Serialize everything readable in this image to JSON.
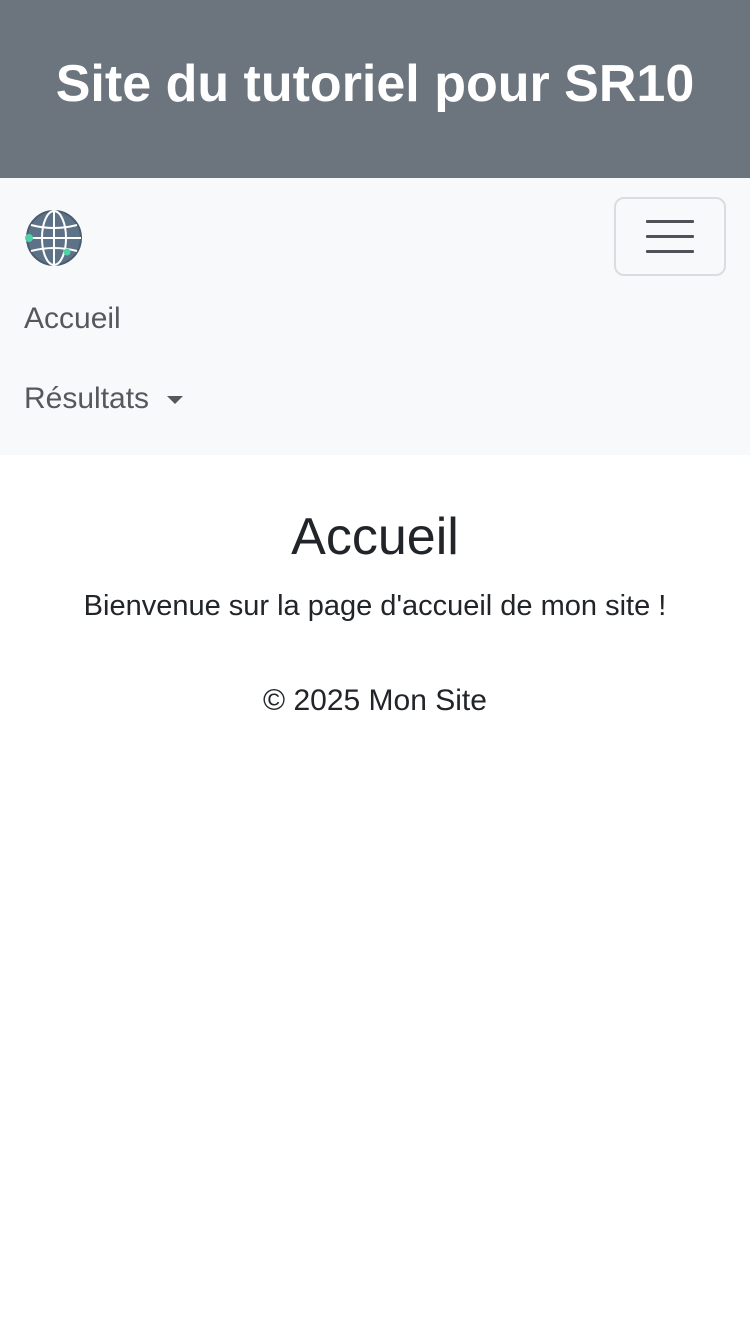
{
  "header": {
    "title": "Site du tutoriel pour SR10",
    "background_color": "#6c757d"
  },
  "navbar": {
    "logo_icon": "globe-icon",
    "toggler_icon": "hamburger-menu-icon",
    "items": [
      {
        "label": "Accueil"
      },
      {
        "label": "Résultats",
        "has_dropdown": true
      }
    ],
    "background_color": "#f8f9fa"
  },
  "main": {
    "heading": "Accueil",
    "intro": "Bienvenue sur la page d'accueil de mon site !"
  },
  "footer": {
    "text": "© 2025 Mon Site"
  }
}
